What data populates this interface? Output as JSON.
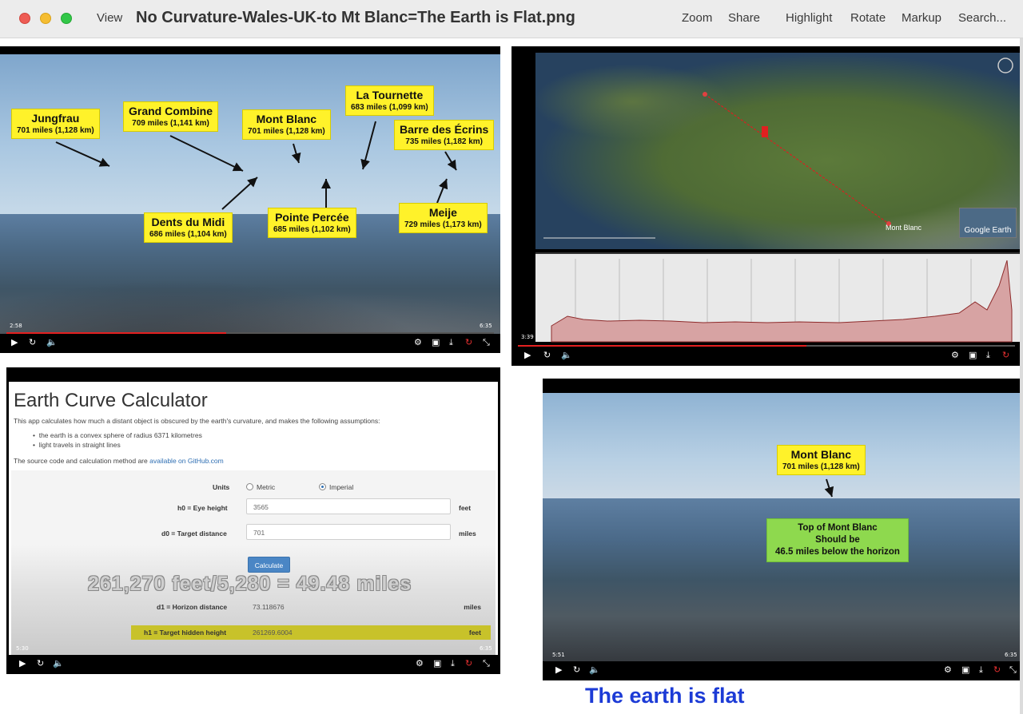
{
  "window": {
    "title": "No Curvature-Wales-UK-to Mt Blanc=The Earth is Flat.png",
    "view_label": "View",
    "toolbar": {
      "zoom": "Zoom",
      "share": "Share",
      "highlight": "Highlight",
      "rotate": "Rotate",
      "markup": "Markup",
      "search": "Search..."
    }
  },
  "panel1": {
    "labels": [
      {
        "name": "Jungfrau",
        "distance": "701 miles (1,128 km)"
      },
      {
        "name": "Grand Combine",
        "distance": "709 miles (1,141 km)"
      },
      {
        "name": "Mont Blanc",
        "distance": "701 miles (1,128 km)"
      },
      {
        "name": "La Tournette",
        "distance": "683 miles (1,099 km)"
      },
      {
        "name": "Barre des Écrins",
        "distance": "735 miles (1,182 km)"
      },
      {
        "name": "Dents du Midi",
        "distance": "686 miles (1,104 km)"
      },
      {
        "name": "Pointe Percée",
        "distance": "685 miles (1,102 km)"
      },
      {
        "name": "Meije",
        "distance": "729 miles (1,173 km)"
      }
    ],
    "time_current": "2:58",
    "time_total": "6:35",
    "progress": 0.45
  },
  "panel2": {
    "map_label_end": "Mont Blanc",
    "logo_text": "Google Earth",
    "time_current": "3:39",
    "progress": 0.58
  },
  "panel3": {
    "title": "Earth Curve Calculator",
    "intro": "This app calculates how much a distant object is obscured by the earth's curvature, and makes the following assumptions:",
    "assumptions": [
      "the earth is a convex sphere of radius 6371 kilometres",
      "light travels in straight lines"
    ],
    "source_text": "The source code and calculation method are",
    "source_link": "available on GitHub.com",
    "units_label": "Units",
    "unit_metric": "Metric",
    "unit_imperial": "Imperial",
    "h0_label": "h0 = Eye height",
    "h0_value": "3565",
    "h0_unit": "feet",
    "d0_label": "d0 = Target distance",
    "d0_value": "701",
    "d0_unit": "miles",
    "calculate_label": "Calculate",
    "overlay_equation": "261,270 feet/5,280 = 49.48 miles",
    "d1_label": "d1 = Horizon distance",
    "d1_value": "73.118676",
    "d1_unit": "miles",
    "h1_label": "h1 = Target hidden height",
    "h1_value": "261269.6004",
    "h1_unit": "feet",
    "time_current": "5:30",
    "time_total": "6:35",
    "progress": 0.83
  },
  "panel4": {
    "label_name": "Mont Blanc",
    "label_distance": "701 miles (1,128 km)",
    "box_line1": "Top of Mont Blanc",
    "box_line2": "Should be",
    "box_line3": "46.5 miles below the horizon",
    "time_current": "5:51",
    "time_total": "6:35",
    "progress": 0.89
  },
  "caption": "The earth is flat"
}
